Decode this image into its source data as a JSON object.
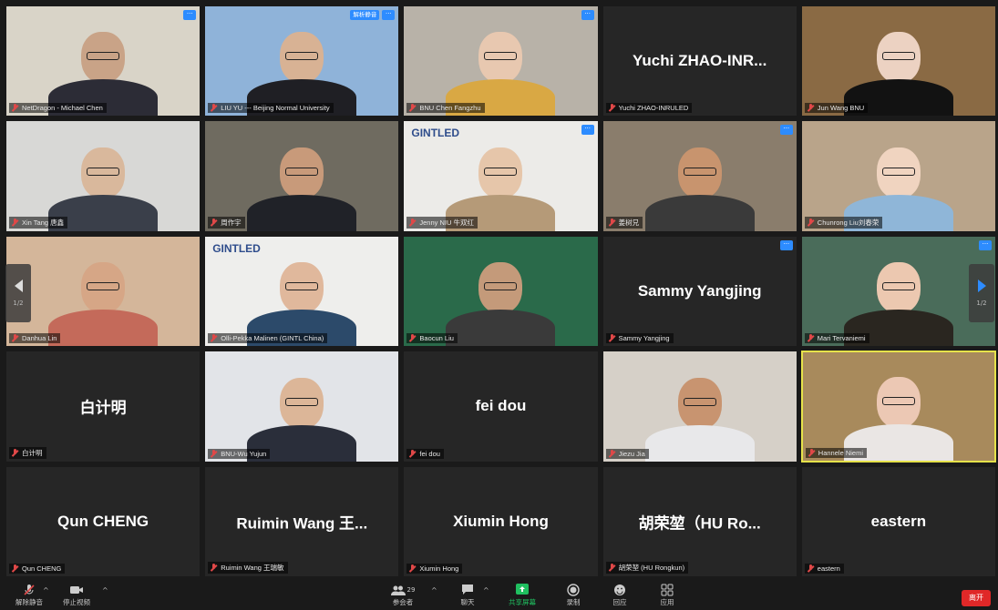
{
  "participants": [
    {
      "name": "NetDragon - Michael Chen",
      "bg": "#d9d4c8",
      "skin": "#c9a387",
      "shirt": "#2c2c36"
    },
    {
      "name": "LIU YU --- Beijing Normal University",
      "bg": "#8fb3d9",
      "skin": "#d8b294",
      "shirt": "#1f1f24",
      "badge": "解析静音"
    },
    {
      "name": "BNU Chen Fangzhu",
      "bg": "#b8b2a8",
      "skin": "#e8c8b0",
      "shirt": "#d9a844"
    },
    {
      "name": "Yuchi ZHAO-INRULED",
      "big": "Yuchi  ZHAO-INR..."
    },
    {
      "name": "Jun Wang BNU",
      "bg": "#8a6a44",
      "skin": "#ecd2c2",
      "shirt": "#121212"
    },
    {
      "name": "Xin Tang 唐鑫",
      "bg": "#d8d8d6",
      "skin": "#d9b89c",
      "shirt": "#3a3f4a"
    },
    {
      "name": "周作宇",
      "bg": "#6f6b60",
      "skin": "#c89a7a",
      "shirt": "#202228"
    },
    {
      "name": "Jenny NIU 牛双红",
      "bg": "#ecebe8",
      "skin": "#e6c6aa",
      "shirt": "#b59a78",
      "logo": "GINTLED"
    },
    {
      "name": "姜树兄",
      "bg": "#8a7d6c",
      "skin": "#c8946e",
      "shirt": "#3a3a3a"
    },
    {
      "name": "Chunrong Liu刘春荣",
      "bg": "#b9a48a",
      "skin": "#f0d4c0",
      "shirt": "#8fb6d8"
    },
    {
      "name": "Danhua Lin",
      "bg": "#d4b69a",
      "skin": "#d6a686",
      "shirt": "#c46a5a"
    },
    {
      "name": "Olli-Pekka Malinen (GINTL China)",
      "bg": "#eeeeec",
      "skin": "#e0b89c",
      "shirt": "#2c4a6a",
      "logo": "GINTLED"
    },
    {
      "name": "Baocun Liu",
      "bg": "#2a6a4a",
      "skin": "#c49a7a",
      "shirt": "#3a3a3a"
    },
    {
      "name": "Sammy Yangjing",
      "big": "Sammy Yangjing"
    },
    {
      "name": "Mari Tervaniemi",
      "bg": "#4a6c5a",
      "skin": "#ecc8b0",
      "shirt": "#2a2620"
    },
    {
      "name": "白计明",
      "big": "白计明"
    },
    {
      "name": "BNU-Wu Yujun",
      "bg": "#e2e4e8",
      "skin": "#dcb698",
      "shirt": "#2a2e3a"
    },
    {
      "name": "fei dou",
      "big": "fei dou"
    },
    {
      "name": "Jiezu Jia",
      "bg": "#d6d0c8",
      "skin": "#c89470",
      "shirt": "#e8e8ea"
    },
    {
      "name": "Hannele Niemi",
      "bg": "#a88a5c",
      "skin": "#ecc8b4",
      "shirt": "#eae6e4",
      "active": true
    },
    {
      "name": "Qun CHENG",
      "big": "Qun CHENG"
    },
    {
      "name": "Ruimin Wang 王瑞敏",
      "big": "Ruimin  Wang 王..."
    },
    {
      "name": "Xiumin Hong",
      "big": "Xiumin Hong"
    },
    {
      "name": "胡荣堃 (HU Rongkun)",
      "big": "胡荣堃（HU  Ro..."
    },
    {
      "name": "eastern",
      "big": "eastern"
    }
  ],
  "pager": {
    "left": "1/2",
    "right": "1/2"
  },
  "toolbar": {
    "mute": "解除静音",
    "video": "停止视频",
    "participants": "参会者",
    "participants_count": "29",
    "chat": "聊天",
    "share": "共享屏幕",
    "record": "录制",
    "reactions": "回应",
    "apps": "应用",
    "leave": "离开"
  },
  "colors": {
    "accent": "#2d8cff",
    "active_border": "#e6e24a",
    "leave": "#e02828",
    "share": "#20c060"
  }
}
